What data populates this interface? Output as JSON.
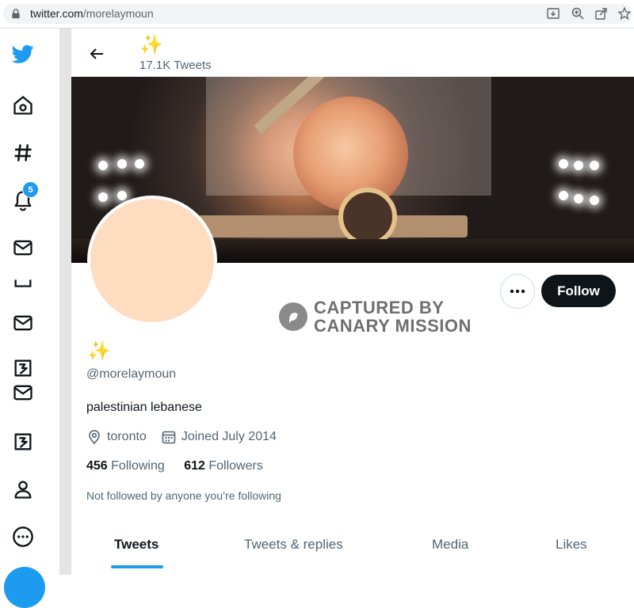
{
  "browser": {
    "url_host": "twitter.com",
    "url_path": "/morelaymoun"
  },
  "nav": {
    "notification_count": "5",
    "icons": [
      "twitter-bird-icon",
      "home-icon",
      "explore-hash-icon",
      "notifications-bell-icon",
      "messages-icon",
      "bookmarks-icon",
      "messages-icon",
      "twitter-blue-icon",
      "messages-icon",
      "twitter-blue-icon",
      "profile-icon",
      "more-icon"
    ]
  },
  "header": {
    "display_name_emoji": "✨",
    "tweets_count": "17.1K Tweets"
  },
  "watermark": {
    "line1": "CAPTURED BY",
    "line2": "CANARY MISSION"
  },
  "profile": {
    "display_name_emoji": "✨",
    "handle": "@morelaymoun",
    "bio": "palestinian lebanese",
    "location": "toronto",
    "joined": "Joined July 2014",
    "following_count": "456",
    "following_label": "Following",
    "followers_count": "612",
    "followers_label": "Followers",
    "not_followed": "Not followed by anyone you’re following"
  },
  "actions": {
    "follow_label": "Follow"
  },
  "tabs": [
    {
      "label": "Tweets",
      "active": true
    },
    {
      "label": "Tweets & replies",
      "active": false
    },
    {
      "label": "Media",
      "active": false
    },
    {
      "label": "Likes",
      "active": false
    }
  ],
  "colors": {
    "accent": "#1d9bf0",
    "follow_bg": "#0f1419",
    "avatar": "#fddcc0"
  }
}
